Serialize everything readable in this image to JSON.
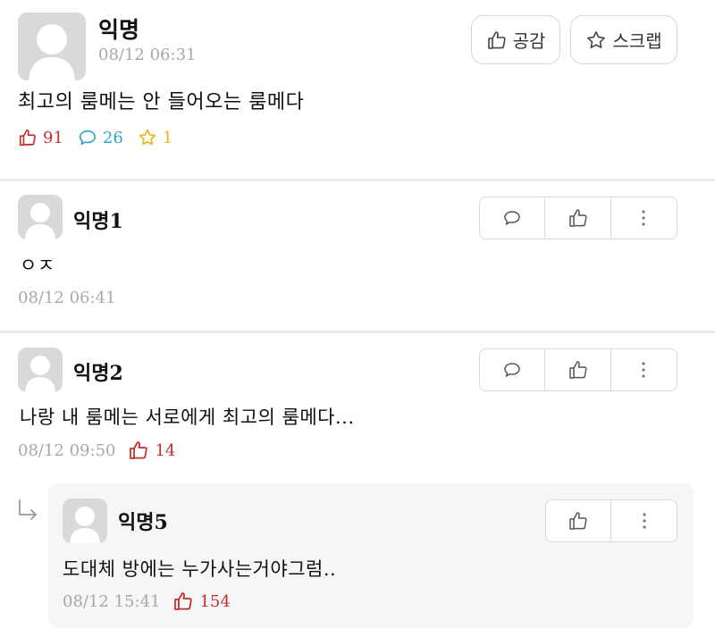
{
  "post": {
    "author": "익명",
    "timestamp": "08/12 06:31",
    "body": "최고의 룸메는 안 들어오는 룸메다",
    "empathy_button_label": "공감",
    "scrap_button_label": "스크랩",
    "stats": {
      "likes": "91",
      "comments": "26",
      "scraps": "1"
    }
  },
  "comments": [
    {
      "author": "익명1",
      "body": "ㅇㅈ",
      "timestamp": "08/12 06:41"
    },
    {
      "author": "익명2",
      "body": "나랑 내 룸메는 서로에게 최고의 룸메다...",
      "timestamp": "08/12 09:50",
      "likes": "14"
    }
  ],
  "reply": {
    "author": "익명5",
    "body": "도대체 방에는 누가사는거야그럼..",
    "timestamp": "08/12 15:41",
    "likes": "154"
  },
  "colors": {
    "like": "#c62f2f",
    "comment": "#2ba6c8",
    "scrap": "#e8b31e",
    "muted_text": "#a8a8a8"
  },
  "icons": [
    "avatar",
    "thumbs-up-icon",
    "comment-bubble-icon",
    "star-icon",
    "more-vertical-icon",
    "reply-arrow-icon"
  ]
}
